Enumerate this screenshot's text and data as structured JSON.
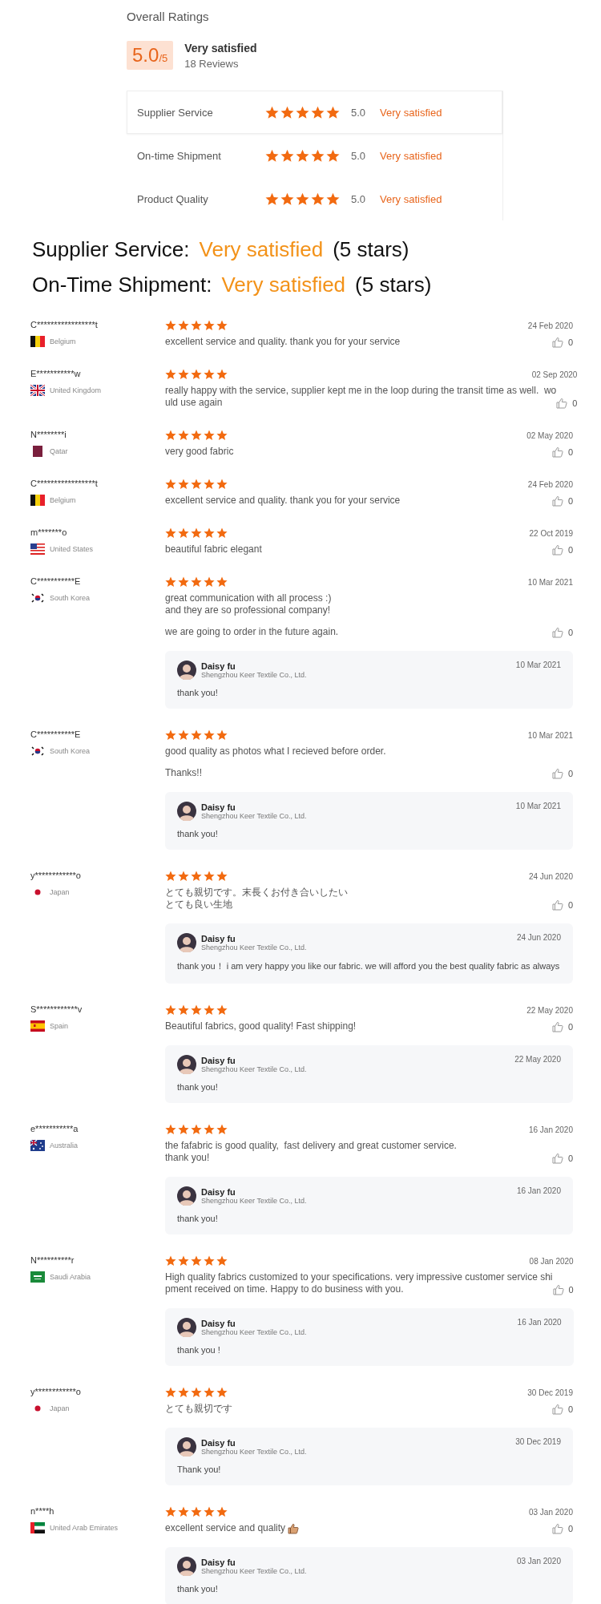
{
  "overall": {
    "title": "Overall Ratings",
    "score": "5.0",
    "score_max": "/5",
    "verdict": "Very satisfied",
    "reviews": "18 Reviews",
    "rows": [
      {
        "label": "Supplier Service",
        "stars": 5,
        "value": "5.0",
        "verdict": "Very satisfied",
        "selected": true
      },
      {
        "label": "On-time Shipment",
        "stars": 5,
        "value": "5.0",
        "verdict": "Very satisfied",
        "selected": false
      },
      {
        "label": "Product Quality",
        "stars": 5,
        "value": "5.0",
        "verdict": "Very satisfied",
        "selected": false
      }
    ]
  },
  "summary": [
    {
      "label": "Supplier Service:",
      "value": "Very satisfied",
      "note": "(5 stars)"
    },
    {
      "label": "On-Time Shipment:",
      "value": "Very satisfied",
      "note": "(5 stars)"
    }
  ],
  "reviews": [
    {
      "user": "C*****************t",
      "country": "Belgium",
      "kind": "belgium",
      "stars": 5,
      "date": "24 Feb 2020",
      "paragraphs": [
        [
          "excellent service and quality. thank you for your service"
        ]
      ],
      "likes": "0"
    },
    {
      "user": "E***********w",
      "country": "United Kingdom",
      "kind": "uk",
      "stars": 5,
      "date": "02 Sep 2020",
      "paragraphs": [
        [
          "really happy with the service, supplier kept me in the loop during the transit time as well.  wo",
          "uld use again"
        ]
      ],
      "likes": "0"
    },
    {
      "user": "N********i",
      "country": "Qatar",
      "kind": "qatar",
      "stars": 5,
      "date": "02 May 2020",
      "paragraphs": [
        [
          "very good fabric"
        ]
      ],
      "likes": "0"
    },
    {
      "user": "C*****************t",
      "country": "Belgium",
      "kind": "belgium",
      "stars": 5,
      "date": "24 Feb 2020",
      "paragraphs": [
        [
          "excellent service and quality. thank you for your service"
        ]
      ],
      "likes": "0"
    },
    {
      "user": "m*******o",
      "country": "United States",
      "kind": "usa",
      "stars": 5,
      "date": "22 Oct 2019",
      "paragraphs": [
        [
          "beautiful fabric elegant"
        ]
      ],
      "likes": "0"
    },
    {
      "user": "C***********E",
      "country": "South Korea",
      "kind": "korea",
      "stars": 5,
      "date": "10 Mar 2021",
      "paragraphs": [
        [
          "great communication with all process :)",
          "and they are so professional company!"
        ],
        [
          "we are going to order in the future again."
        ]
      ],
      "likes": "0",
      "reply": {
        "name": "Daisy fu",
        "company": "Shengzhou Keer Textile Co., Ltd.",
        "date": "10 Mar 2021",
        "text": "thank you!"
      }
    },
    {
      "user": "C***********E",
      "country": "South Korea",
      "kind": "korea",
      "stars": 5,
      "date": "10 Mar 2021",
      "paragraphs": [
        [
          "good quality as photos what I recieved before order."
        ],
        [
          "Thanks!!"
        ]
      ],
      "likes": "0",
      "reply": {
        "name": "Daisy fu",
        "company": "Shengzhou Keer Textile Co., Ltd.",
        "date": "10 Mar 2021",
        "text": "thank you!"
      }
    },
    {
      "user": "y************o",
      "country": "Japan",
      "kind": "japan",
      "stars": 5,
      "date": "24 Jun 2020",
      "paragraphs": [
        [
          "とても親切です。末長くお付き合いしたい",
          "とても良い生地"
        ]
      ],
      "likes": "0",
      "reply": {
        "name": "Daisy fu",
        "company": "Shengzhou Keer Textile Co., Ltd.",
        "date": "24 Jun 2020",
        "text": "thank you！ i am very happy you like our fabric. we will afford you the best quality fabric as always"
      }
    },
    {
      "user": "S************v",
      "country": "Spain",
      "kind": "spain",
      "stars": 5,
      "date": "22 May 2020",
      "paragraphs": [
        [
          "Beautiful fabrics, good quality! Fast shipping!"
        ]
      ],
      "likes": "0",
      "reply": {
        "name": "Daisy fu",
        "company": "Shengzhou Keer Textile Co., Ltd.",
        "date": "22 May 2020",
        "text": "thank you!"
      }
    },
    {
      "user": "e***********a",
      "country": "Australia",
      "kind": "australia",
      "stars": 5,
      "date": "16 Jan 2020",
      "paragraphs": [
        [
          "the fafabric is good quality,  fast delivery and great customer service.",
          "thank you!"
        ]
      ],
      "likes": "0",
      "reply": {
        "name": "Daisy fu",
        "company": "Shengzhou Keer Textile Co., Ltd.",
        "date": "16 Jan 2020",
        "text": "thank you!"
      }
    },
    {
      "user": "N**********r",
      "country": "Saudi Arabia",
      "kind": "saudi",
      "stars": 5,
      "date": "08 Jan 2020",
      "paragraphs": [
        [
          "High quality fabrics customized to your specifications. very impressive customer service shi",
          "pment received on time. Happy to do business with you."
        ]
      ],
      "likes": "0",
      "reply": {
        "name": "Daisy fu",
        "company": "Shengzhou Keer Textile Co., Ltd.",
        "date": "16 Jan 2020",
        "text": "thank you !"
      }
    },
    {
      "user": "y************o",
      "country": "Japan",
      "kind": "japan",
      "stars": 5,
      "date": "30 Dec 2019",
      "paragraphs": [
        [
          "とても親切です"
        ]
      ],
      "likes": "0",
      "reply": {
        "name": "Daisy fu",
        "company": "Shengzhou Keer Textile Co., Ltd.",
        "date": "30 Dec 2019",
        "text": "Thank you!"
      }
    },
    {
      "user": "n****h",
      "country": "United Arab Emirates",
      "kind": "uae",
      "stars": 5,
      "date": "03 Jan 2020",
      "paragraphs": [
        [
          "excellent service and quality"
        ]
      ],
      "thumb_emoji": true,
      "likes": "0",
      "reply": {
        "name": "Daisy fu",
        "company": "Shengzhou Keer Textile Co., Ltd.",
        "date": "03 Jan 2020",
        "text": "thank you!"
      }
    }
  ]
}
